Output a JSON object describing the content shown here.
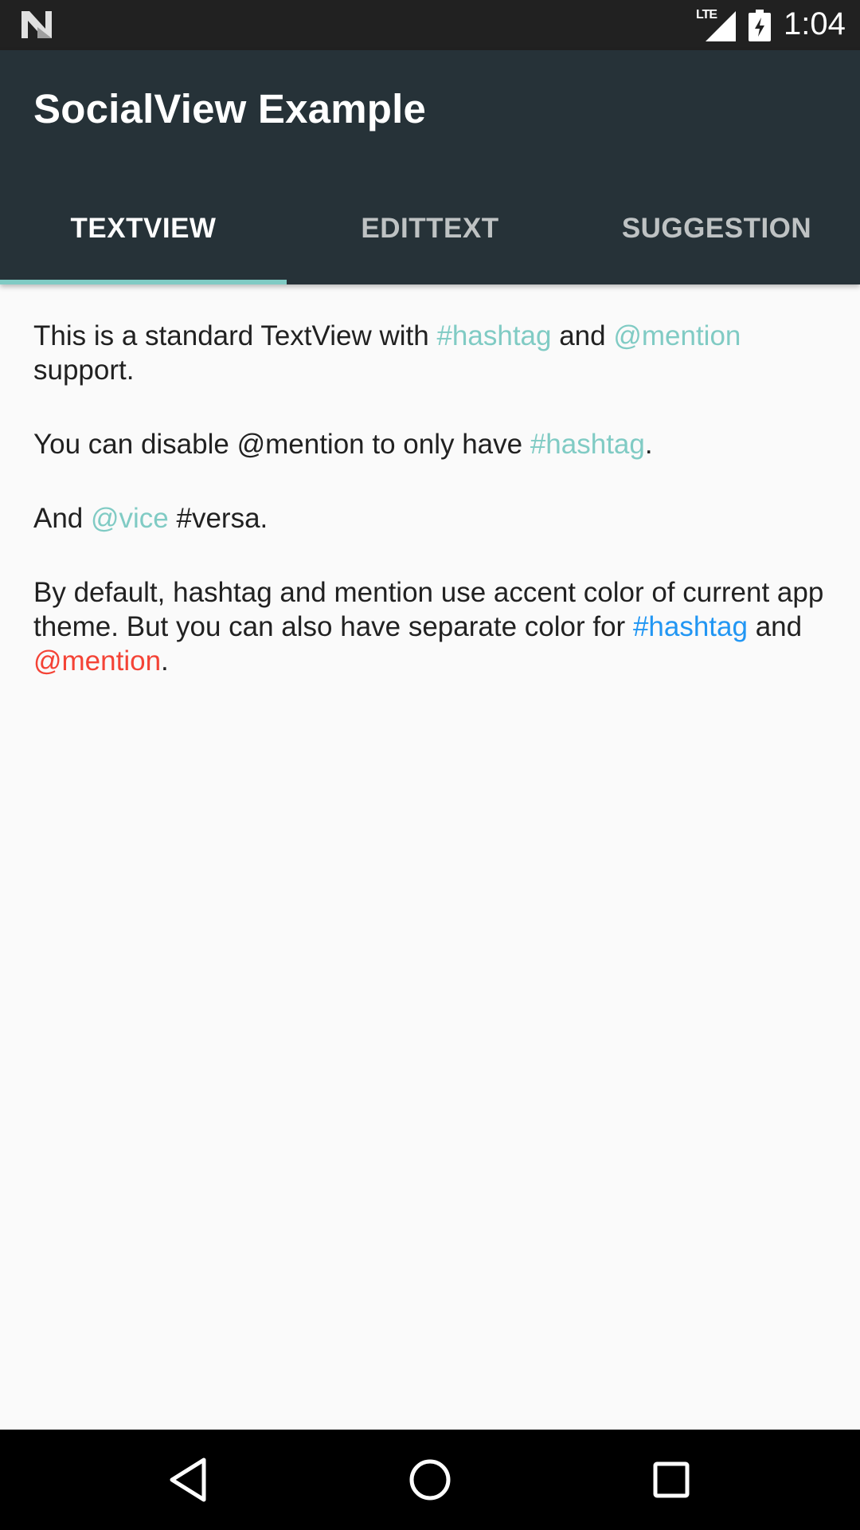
{
  "status_bar": {
    "network": "LTE",
    "time": "1:04",
    "icons": [
      "n-logo-icon",
      "signal-icon",
      "battery-icon"
    ]
  },
  "app_bar": {
    "title": "SocialView Example"
  },
  "tabs": [
    {
      "label": "TEXTVIEW",
      "active": true
    },
    {
      "label": "EDITTEXT",
      "active": false
    },
    {
      "label": "SUGGESTION",
      "active": false
    }
  ],
  "content": {
    "p1": {
      "t1": "This is a standard TextView with ",
      "hashtag": "#hashtag",
      "t2": " and ",
      "mention": "@mention",
      "t3": " support."
    },
    "p2": {
      "t1": "You can disable @mention to only have ",
      "hashtag": "#hashtag",
      "t2": "."
    },
    "p3": {
      "t1": "And ",
      "mention": "@vice",
      "t2": " #versa."
    },
    "p4": {
      "t1": "By default, hashtag and mention use accent color of current app theme. But you can also have separate color for ",
      "hashtag": "#hashtag",
      "t2": " and ",
      "mention": "@mention",
      "t3": "."
    }
  },
  "colors": {
    "app_bar": "#263238",
    "accent": "#80cbc4",
    "hashtag_custom": "#2196f3",
    "mention_custom": "#f44336"
  },
  "nav_bar": {
    "icons": [
      "back-icon",
      "home-icon",
      "recents-icon"
    ]
  }
}
